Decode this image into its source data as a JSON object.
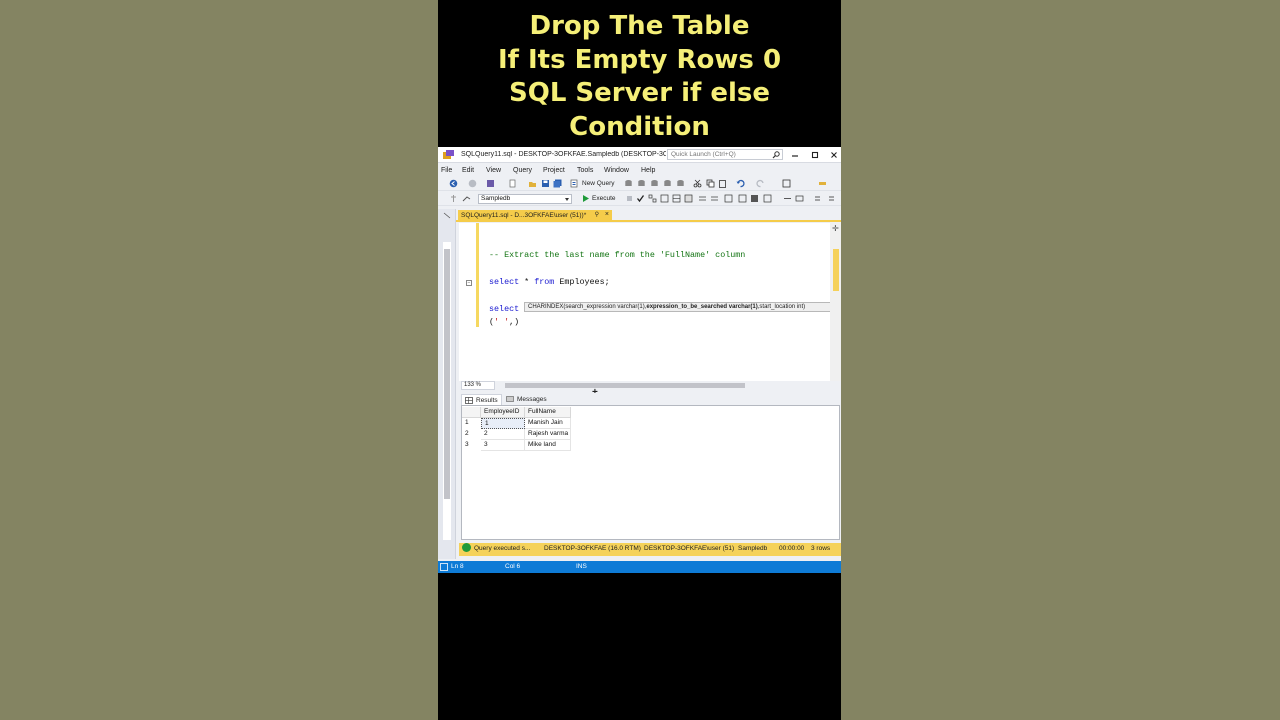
{
  "headline": {
    "line1": "Drop The Table",
    "line2": "If Its Empty Rows 0",
    "line3": "SQL Server if else",
    "line4": "Condition"
  },
  "window": {
    "title": "SQLQuery11.sql - DESKTOP-3OFKFAE.Sampledb (DESKTOP-3OFK...",
    "quick_launch_placeholder": "Quick Launch (Ctrl+Q)"
  },
  "menu": {
    "items": [
      "File",
      "Edit",
      "View",
      "Query",
      "Project",
      "Tools",
      "Window",
      "Help"
    ]
  },
  "toolbar": {
    "new_query_label": "New Query",
    "database": "Sampledb",
    "execute_label": "Execute"
  },
  "doc_tab": {
    "label": "SQLQuery11.sql - D...3OFKFAE\\user (51))*"
  },
  "editor": {
    "line_comment": "-- Extract the last name from the 'FullName' column",
    "line_select_kw": "select",
    "line_select_star": " * ",
    "line_select_from": "from",
    "line_select_table": " Employees;",
    "line_select2": "select",
    "line_args_open": "(",
    "line_args_str": "' '",
    "line_args_close": ",)"
  },
  "tooltip": {
    "part1": "CHARINDEX(search_expression varchar(1),",
    "part2": "expression_to_be_searched varchar(1)",
    "part3": ",start_location int)"
  },
  "zoom": "133 %",
  "results": {
    "tabs": [
      "Results",
      "Messages"
    ],
    "columns": [
      "EmployeeID",
      "FullName"
    ],
    "rows": [
      {
        "num": "1",
        "id": "1",
        "name": "Manish Jain"
      },
      {
        "num": "2",
        "id": "2",
        "name": "Rajesh varma"
      },
      {
        "num": "3",
        "id": "3",
        "name": "Mike land"
      }
    ]
  },
  "query_status": {
    "message": "Query executed s...",
    "server": "DESKTOP-3OFKFAE (16.0 RTM)",
    "user": "DESKTOP-3OFKFAE\\user (51)",
    "database": "Sampledb",
    "time": "00:00:00",
    "rows": "3 rows"
  },
  "statusbar": {
    "ln": "Ln 8",
    "col": "Col 6",
    "mode": "INS"
  },
  "colors": {
    "headline": "#f5ef78",
    "tab_accent": "#f5cc4a",
    "status_blue": "#0e7bd6",
    "comment": "#137413",
    "keyword": "#1a1ad0",
    "string": "#c21a1a"
  }
}
